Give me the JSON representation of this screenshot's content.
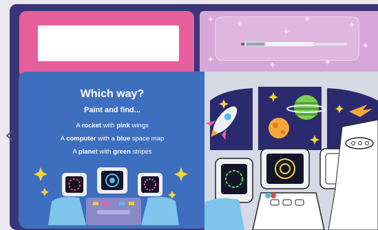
{
  "flap": {
    "title": "Which way?",
    "subtitle": "Paint and find...",
    "items": [
      {
        "prefix": "A ",
        "bold1": "rocket",
        "middle": " with ",
        "bold2": "pink",
        "suffix": " wings"
      },
      {
        "prefix": "A ",
        "bold1": "computer",
        "middle": " with a ",
        "bold2": "blue",
        "suffix": " space map"
      },
      {
        "prefix": "A ",
        "bold1": "planet",
        "middle": " with ",
        "bold2": "green",
        "suffix": " stripes"
      }
    ]
  },
  "colors": {
    "frame": "#3a3579",
    "pink_card": "#e85f9e",
    "tray": "#d9a6da",
    "flap": "#3e6fbf",
    "space": "#2c2a6e",
    "cockpit": "#d6d8e4"
  },
  "icons": {
    "brush": "paint-brush-icon",
    "rocket": "rocket-icon",
    "planet": "planet-icon",
    "computer": "computer-icon",
    "arrow": "arrow-left-icon"
  }
}
